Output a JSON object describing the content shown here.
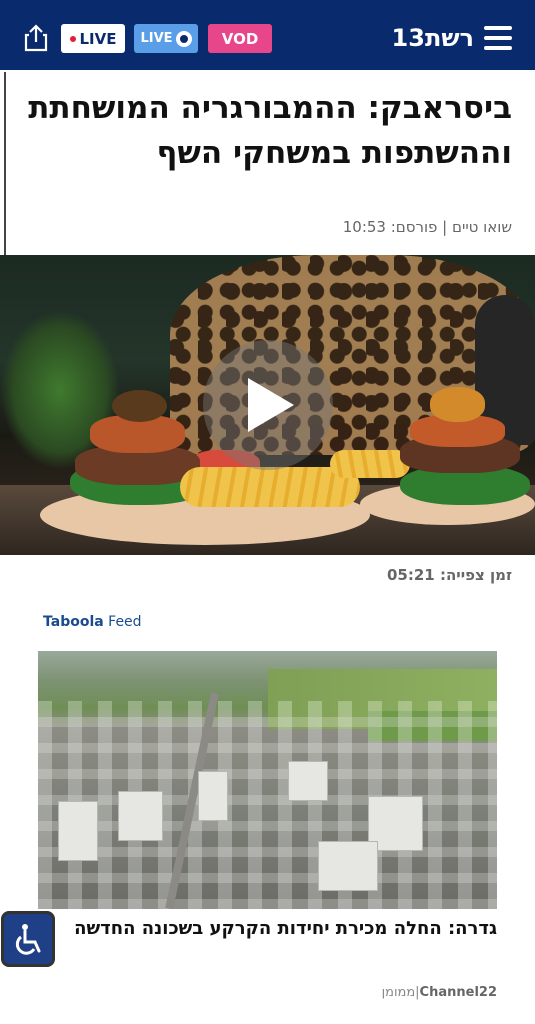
{
  "header": {
    "live_label": "LIVE",
    "live_cam_label": "LIVE",
    "vod_label": "VOD",
    "logo_text": "רשת13",
    "share_icon": "share-icon",
    "menu_icon": "hamburger-menu-icon",
    "colors": {
      "bar": "#0a2a6e",
      "live_cam": "#5b9ee8",
      "vod": "#e8468a"
    }
  },
  "article": {
    "title": "ביסראבק: ההמבורגריה המושחתת וההשתפות במשחקי השף",
    "byline": "שואו טיים | פורסם: 10:53"
  },
  "video": {
    "play_icon": "play-icon",
    "duration": "זמן צפייה: 05:21"
  },
  "taboola": {
    "brand": "Taboola",
    "feed": " Feed"
  },
  "promo": {
    "title": "גדרה: החלה מכירת יחידות הקרקע בשכונה החדשה",
    "source_name": "Channel22",
    "sponsored": "ממומן",
    "separator": "|"
  },
  "accessibility": {
    "icon": "accessibility-icon"
  }
}
